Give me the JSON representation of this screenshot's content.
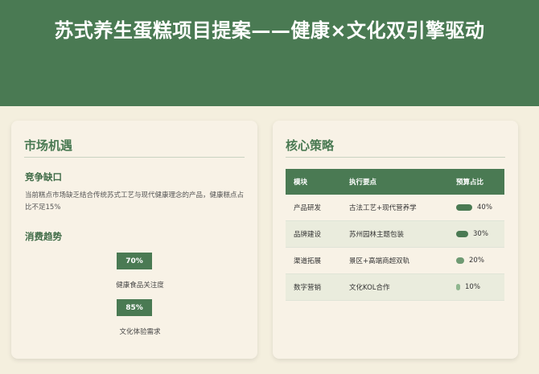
{
  "hero": {
    "title": "苏式养生蛋糕项目提案——健康×文化双引擎驱动"
  },
  "market": {
    "title": "市场机遇",
    "competition_title": "竞争缺口",
    "competition_text": "当前糕点市场缺乏结合传统苏式工艺与现代健康理念的产品，健康糕点占比不足15%",
    "trend_title": "消费趋势",
    "trends": [
      {
        "value": "70%",
        "label": "健康食品关注度",
        "percent": 70
      },
      {
        "value": "85%",
        "label": "文化体验需求",
        "percent": 85
      }
    ]
  },
  "strategy": {
    "title": "核心策略",
    "headers": [
      "模块",
      "执行要点",
      "预算占比"
    ],
    "rows": [
      {
        "module": "产品研发",
        "point": "古法工艺+现代营养学",
        "budget": "40%",
        "percent": 40
      },
      {
        "module": "品牌建设",
        "point": "苏州园林主题包装",
        "budget": "30%",
        "percent": 30
      },
      {
        "module": "渠道拓展",
        "point": "景区+高端商超双轨",
        "budget": "20%",
        "percent": 20
      },
      {
        "module": "数字营销",
        "point": "文化KOL合作",
        "budget": "10%",
        "percent": 10
      }
    ]
  },
  "colors": {
    "primary": "#4a7a53",
    "background": "#f4efde",
    "card": "#f8f2e6"
  }
}
